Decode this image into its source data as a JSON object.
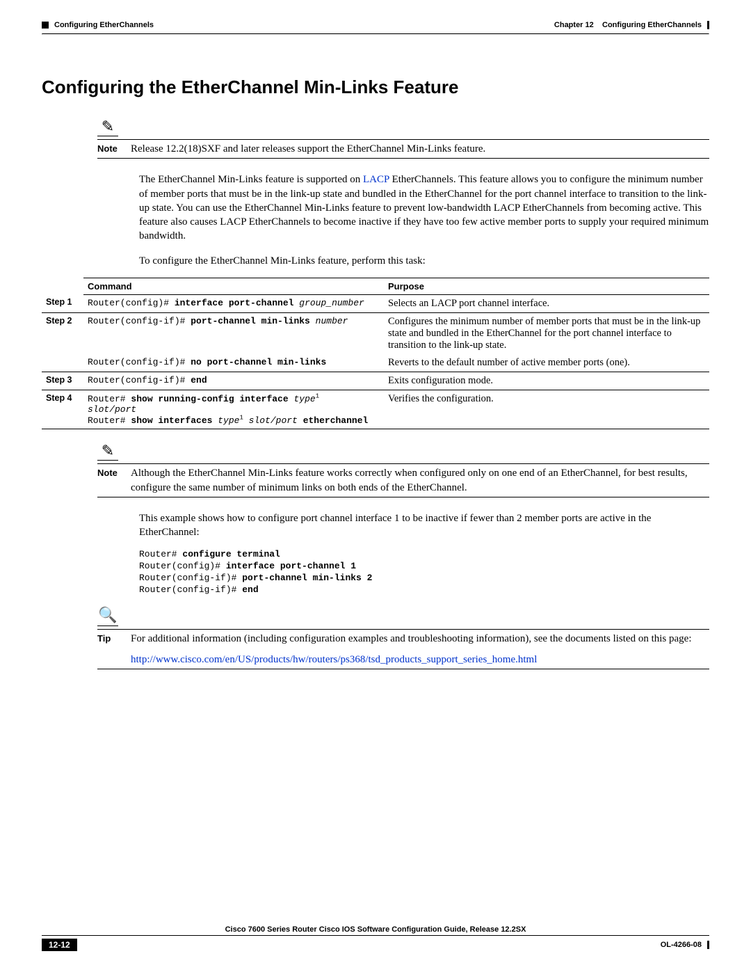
{
  "header": {
    "left": "Configuring EtherChannels",
    "right_prefix": "Chapter 12",
    "right_title": "Configuring EtherChannels"
  },
  "title": "Configuring the EtherChannel Min-Links Feature",
  "note1": {
    "label": "Note",
    "text": "Release 12.2(18)SXF and later releases support the EtherChannel Min-Links feature."
  },
  "para1_a": "The EtherChannel Min-Links feature is supported on ",
  "para1_link": "LACP",
  "para1_b": " EtherChannels. This feature allows you to configure the minimum number of member ports that must be in the link-up state and bundled in the EtherChannel for the port channel interface to transition to the link-up state. You can use the EtherChannel Min-Links feature to prevent low-bandwidth LACP EtherChannels from becoming active. This feature also causes LACP EtherChannels to become inactive if they have too few active member ports to supply your required minimum bandwidth.",
  "para2": "To configure the EtherChannel Min-Links feature, perform this task:",
  "table": {
    "headers": {
      "command": "Command",
      "purpose": "Purpose"
    },
    "rows": [
      {
        "step": "Step 1",
        "cmd": {
          "prefix": "Router(config)# ",
          "bold": "interface port-channel ",
          "italic": "group_number"
        },
        "purpose": "Selects an LACP port channel interface."
      },
      {
        "step": "Step 2",
        "cmd": {
          "prefix": "Router(config-if)# ",
          "bold": "port-channel min-links ",
          "italic": "number"
        },
        "purpose": "Configures the minimum number of member ports that must be in the link-up state and bundled in the EtherChannel for the port channel interface to transition to the link-up state."
      },
      {
        "step": "",
        "cmd": {
          "prefix": "Router(config-if)# ",
          "bold": "no port-channel min-links",
          "italic": ""
        },
        "purpose": "Reverts to the default number of active member ports (one)."
      },
      {
        "step": "Step 3",
        "cmd": {
          "prefix": "Router(config-if)# ",
          "bold": "end",
          "italic": ""
        },
        "purpose": "Exits configuration mode."
      },
      {
        "step": "Step 4",
        "cmd_lines": [
          {
            "prefix": "Router# ",
            "bold": "show running-config interface ",
            "italic": "type",
            "sup": "1"
          },
          {
            "prefix": "",
            "bold": "",
            "italic": "slot/port"
          },
          {
            "prefix": "Router# ",
            "bold": "show interfaces ",
            "italic": "type",
            "sup": "1",
            "post_italic": " slot/port ",
            "post_bold": "etherchannel"
          }
        ],
        "purpose": "Verifies the configuration."
      }
    ]
  },
  "note2": {
    "label": "Note",
    "text": "Although the EtherChannel Min-Links feature works correctly when configured only on one end of an EtherChannel, for best results, configure the same number of minimum links on both ends of the EtherChannel."
  },
  "para3": "This example shows how to configure port channel interface 1 to be inactive if fewer than 2 member ports are active in the EtherChannel:",
  "example": [
    {
      "p": "Router# ",
      "b": "configure terminal"
    },
    {
      "p": "Router(config)# ",
      "b": "interface port-channel 1"
    },
    {
      "p": "Router(config-if)# ",
      "b": "port-channel min-links 2"
    },
    {
      "p": "Router(config-if)# ",
      "b": "end"
    }
  ],
  "tip": {
    "label": "Tip",
    "text": "For additional information (including configuration examples and troubleshooting information), see the documents listed on this page:",
    "link": "http://www.cisco.com/en/US/products/hw/routers/ps368/tsd_products_support_series_home.html"
  },
  "footer": {
    "title": "Cisco 7600 Series Router Cisco IOS Software Configuration Guide, Release 12.2SX",
    "page": "12-12",
    "docid": "OL-4266-08"
  }
}
